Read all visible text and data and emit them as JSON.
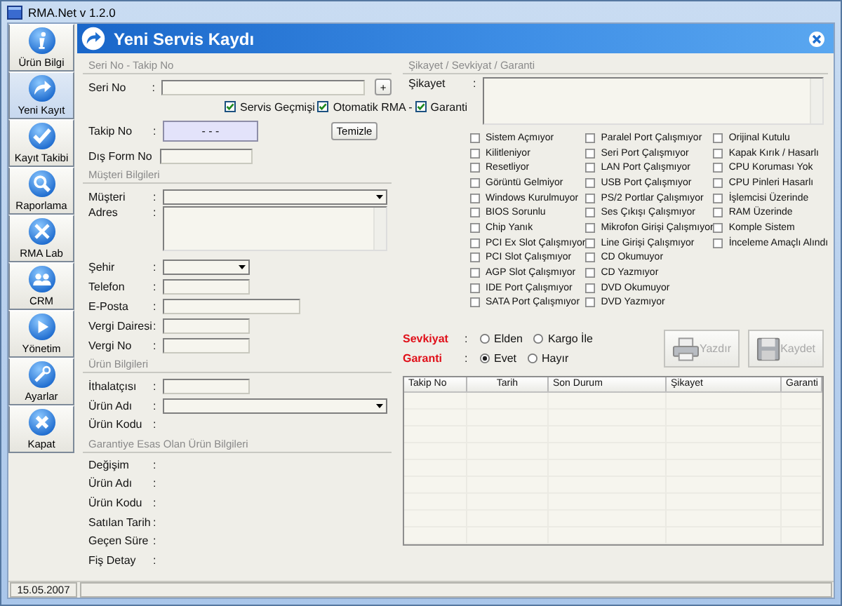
{
  "window": {
    "title": "RMA.Net v 1.2.0"
  },
  "sidebar": {
    "items": [
      {
        "label": "Ürün Bilgi",
        "kind": "info",
        "selected": false
      },
      {
        "label": "Yeni Kayıt",
        "kind": "arrow",
        "selected": true
      },
      {
        "label": "Kayıt Takibi",
        "kind": "check",
        "selected": false
      },
      {
        "label": "Raporlama",
        "kind": "search",
        "selected": false
      },
      {
        "label": "RMA Lab",
        "kind": "tools",
        "selected": false
      },
      {
        "label": "CRM",
        "kind": "people",
        "selected": false
      },
      {
        "label": "Yönetim",
        "kind": "play",
        "selected": false
      },
      {
        "label": "Ayarlar",
        "kind": "wrench",
        "selected": false
      },
      {
        "label": "Kapat",
        "kind": "close",
        "selected": false
      }
    ]
  },
  "header": {
    "title": "Yeni Servis Kaydı"
  },
  "serial": {
    "title": "Seri No - Takip No",
    "seri_no": {
      "label": "Seri No",
      "sep": ":",
      "button": "+"
    },
    "checkboxes": [
      {
        "label": "Servis Geçmişi",
        "checked": true
      },
      {
        "label": "Otomatik RMA -",
        "checked": true
      },
      {
        "label": "Garanti",
        "checked": true
      }
    ],
    "takip_no": {
      "label": "Takip No",
      "sep": ":",
      "value": "- - -"
    },
    "clear_button": "Temizle",
    "dis_form": {
      "label": "Dış Form No"
    }
  },
  "sections": [
    {
      "title": "Müşteri Bilgileri",
      "fields": [
        {
          "label": "Müşteri",
          "sep": ":",
          "kind": "combo-long"
        },
        {
          "label": "Adres",
          "sep": ":",
          "kind": "area"
        },
        {
          "label": "Şehir",
          "sep": ":",
          "kind": "combo-short"
        },
        {
          "label": "Telefon",
          "sep": ":",
          "kind": "short"
        },
        {
          "label": "E-Posta",
          "sep": ":",
          "kind": "medium"
        },
        {
          "label": "Vergi Dairesi",
          "sep": ":",
          "kind": "short"
        },
        {
          "label": "Vergi No",
          "sep": ":",
          "kind": "short"
        }
      ]
    },
    {
      "title": "Ürün Bilgileri",
      "fields": [
        {
          "label": "İthalatçısı",
          "sep": ":",
          "kind": "short"
        },
        {
          "label": "Ürün Adı",
          "sep": ":",
          "kind": "combo-long"
        },
        {
          "label": "Ürün Kodu",
          "sep": ":",
          "kind": "none"
        }
      ]
    },
    {
      "title": "Garantiye Esas Olan Ürün Bilgileri",
      "fields": [
        {
          "label": "Değişim",
          "sep": ":",
          "kind": "none"
        },
        {
          "label": "Ürün Adı",
          "sep": ":",
          "kind": "none"
        },
        {
          "label": "Ürün Kodu",
          "sep": ":",
          "kind": "none"
        },
        {
          "label": "Satılan Tarih",
          "sep": ":",
          "kind": "none"
        },
        {
          "label": "Geçen Süre",
          "sep": ":",
          "kind": "none"
        },
        {
          "label": "Fiş Detay",
          "sep": ":",
          "kind": "none"
        }
      ]
    }
  ],
  "complaint": {
    "title": "Şikayet / Sevkiyat / Garanti",
    "label": "Şikayet",
    "sep": ":",
    "columns": [
      {
        "items": [
          {
            "label": "Sistem Açmıyor",
            "checked": false
          },
          {
            "label": "Kilitleniyor",
            "checked": false
          },
          {
            "label": "Resetliyor",
            "checked": false
          },
          {
            "label": "Görüntü Gelmiyor",
            "checked": false
          },
          {
            "label": "Windows Kurulmuyor",
            "checked": false
          },
          {
            "label": "BIOS Sorunlu",
            "checked": false
          },
          {
            "label": "Chip Yanık",
            "checked": false
          },
          {
            "label": "PCI Ex Slot Çalışmıyor",
            "checked": false
          },
          {
            "label": "PCI Slot Çalışmıyor",
            "checked": false
          },
          {
            "label": "AGP Slot Çalışmıyor",
            "checked": false
          },
          {
            "label": "IDE Port Çalışmıyor",
            "checked": false
          },
          {
            "label": "SATA Port Çalışmıyor",
            "checked": false
          }
        ]
      },
      {
        "items": [
          {
            "label": "Paralel Port Çalışmıyor",
            "checked": false
          },
          {
            "label": "Seri Port Çalışmıyor",
            "checked": false
          },
          {
            "label": "LAN Port Çalışmıyor",
            "checked": false
          },
          {
            "label": "USB Port Çalışmıyor",
            "checked": false
          },
          {
            "label": "PS/2 Portlar Çalışmıyor",
            "checked": false
          },
          {
            "label": "Ses Çıkışı Çalışmıyor",
            "checked": false
          },
          {
            "label": "Mikrofon Girişi Çalışmıyor",
            "checked": false
          },
          {
            "label": "Line Girişi Çalışmıyor",
            "checked": false
          },
          {
            "label": "CD Okumuyor",
            "checked": false
          },
          {
            "label": "CD Yazmıyor",
            "checked": false
          },
          {
            "label": "DVD Okumuyor",
            "checked": false
          },
          {
            "label": "DVD Yazmıyor",
            "checked": false
          }
        ]
      },
      {
        "items": [
          {
            "label": "Orijinal Kutulu",
            "checked": false
          },
          {
            "label": "Kapak Kırık / Hasarlı",
            "checked": false
          },
          {
            "label": "CPU Koruması Yok",
            "checked": false
          },
          {
            "label": "CPU Pinleri Hasarlı",
            "checked": false
          },
          {
            "label": "İşlemcisi Üzerinde",
            "checked": false
          },
          {
            "label": "RAM Üzerinde",
            "checked": false
          },
          {
            "label": "Komple Sistem",
            "checked": false
          },
          {
            "label": "İnceleme Amaçlı Alındı",
            "checked": false
          }
        ]
      }
    ]
  },
  "options": [
    {
      "label": "Sevkiyat",
      "sep": ":",
      "choices": [
        {
          "label": "Elden",
          "selected": false
        },
        {
          "label": "Kargo İle",
          "selected": false
        }
      ]
    },
    {
      "label": "Garanti",
      "sep": ":",
      "choices": [
        {
          "label": "Evet",
          "selected": true
        },
        {
          "label": "Hayır",
          "selected": false
        }
      ]
    }
  ],
  "actions": [
    {
      "label": "Yazdır",
      "kind": "print",
      "disabled": true
    },
    {
      "label": "Kaydet",
      "kind": "save",
      "disabled": true
    }
  ],
  "table": {
    "columns": [
      "Takip No",
      "Tarih",
      "Son Durum",
      "Şikayet",
      "Garanti"
    ]
  },
  "status_bar": {
    "date": "15.05.2007"
  }
}
